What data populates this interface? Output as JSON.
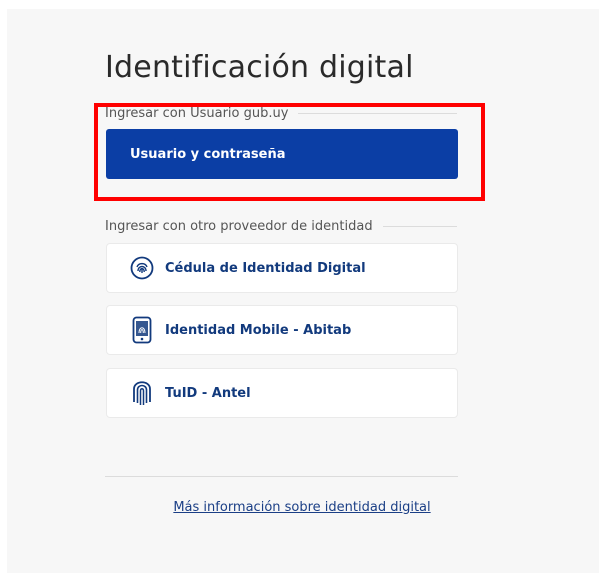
{
  "page": {
    "title": "Identificación digital"
  },
  "gubuy_section": {
    "label": "Ingresar con Usuario gub.uy",
    "button_label": "Usuario y contraseña"
  },
  "other_section": {
    "label": "Ingresar con otro proveedor de identidad",
    "providers": [
      {
        "label": "Cédula de Identidad Digital",
        "icon": "fingerprint-circle-icon"
      },
      {
        "label": "Identidad Mobile - Abitab",
        "icon": "mobile-fingerprint-icon"
      },
      {
        "label": "TuID - Antel",
        "icon": "fingerprint-icon"
      }
    ]
  },
  "footer": {
    "more_info_link": "Más información sobre identidad digital"
  },
  "colors": {
    "primary": "#0b3ea5",
    "provider_text": "#123a7d",
    "highlight": "#ff0000"
  }
}
